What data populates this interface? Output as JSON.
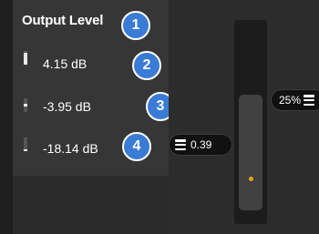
{
  "output_level": {
    "title": "Output Level",
    "rows": [
      {
        "value": "4.15 dB",
        "badge": "2",
        "meter_level": 0.9
      },
      {
        "value": "-3.95 dB",
        "badge": "3",
        "meter_level": 0.2
      },
      {
        "value": "-18.14 dB",
        "badge": "4",
        "meter_level": 0.1
      }
    ],
    "title_badge": "1"
  },
  "gain_pill": {
    "value": "0.39"
  },
  "percent_pill": {
    "value": "25%"
  },
  "slider": {
    "level": 0.25
  },
  "icons": {
    "menu": "hamburger-icon",
    "accent_dot": "#f0a020",
    "badge_color": "#3a7bd5"
  }
}
